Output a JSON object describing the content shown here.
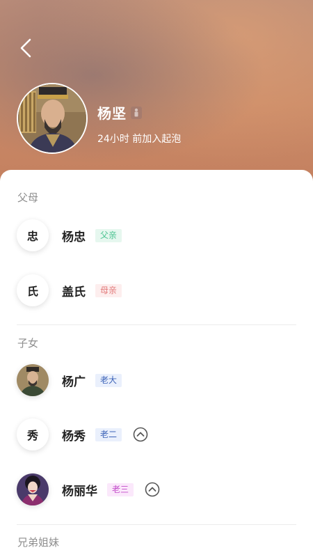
{
  "header": {
    "back_icon": "chevron-left-icon",
    "name": "杨坚",
    "gender_icon": "male-icon",
    "joined": "24小时 前加入起泡"
  },
  "sections": {
    "parents": {
      "title": "父母",
      "members": [
        {
          "avatar_char": "忠",
          "name": "杨忠",
          "tag": "父亲",
          "tag_color": "#49c28f"
        },
        {
          "avatar_char": "氏",
          "name": "盖氏",
          "tag": "母亲",
          "tag_color": "#e27b7b"
        }
      ]
    },
    "children": {
      "title": "子女",
      "members": [
        {
          "avatar_image": "portrait-photo",
          "name": "杨广",
          "tag": "老大",
          "tag_color": "#3d63b8"
        },
        {
          "avatar_char": "秀",
          "name": "杨秀",
          "tag": "老二",
          "tag_color": "#3d63b8",
          "action_icon": "chevron-up-circle-icon"
        },
        {
          "avatar_image": "portrait-photo",
          "name": "杨丽华",
          "tag": "老三",
          "tag_color": "#c24bc9",
          "action_icon": "chevron-up-circle-icon"
        }
      ]
    },
    "siblings": {
      "title": "兄弟姐妹"
    }
  }
}
